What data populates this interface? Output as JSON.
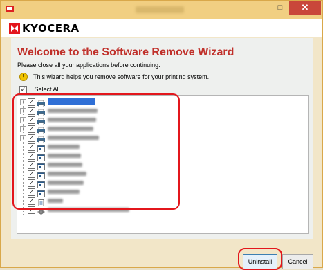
{
  "window": {
    "brand": "KYOCERA",
    "controls": {
      "minimize": "–",
      "maximize": "□",
      "close": "✕"
    }
  },
  "wizard": {
    "heading": "Welcome to the Software Remove Wizard",
    "subheading": "Please close all your applications before continuing.",
    "info": "This wizard helps you remove software for your printing system.",
    "select_all_label": "Select All",
    "select_all_checked": "✓"
  },
  "tree": {
    "rows": [
      {
        "expander": "+",
        "checked": "✓",
        "icon": "printer-icon",
        "selected": true
      },
      {
        "expander": "+",
        "checked": "✓",
        "icon": "printer-icon",
        "selected": false
      },
      {
        "expander": "+",
        "checked": "✓",
        "icon": "printer-icon",
        "selected": false
      },
      {
        "expander": "+",
        "checked": "✓",
        "icon": "printer-icon",
        "selected": false
      },
      {
        "expander": "+",
        "checked": "✓",
        "icon": "printer-icon",
        "selected": false
      },
      {
        "expander": "",
        "checked": "✓",
        "icon": "application-icon",
        "selected": false
      },
      {
        "expander": "",
        "checked": "✓",
        "icon": "application-icon",
        "selected": false
      },
      {
        "expander": "",
        "checked": "✓",
        "icon": "application-icon",
        "selected": false
      },
      {
        "expander": "",
        "checked": "✓",
        "icon": "application-icon",
        "selected": false
      },
      {
        "expander": "",
        "checked": "✓",
        "icon": "application-icon",
        "selected": false
      },
      {
        "expander": "",
        "checked": "✓",
        "icon": "application-icon",
        "selected": false
      },
      {
        "expander": "",
        "checked": "✓",
        "icon": "document-icon",
        "selected": false
      },
      {
        "expander": "",
        "checked": "✓",
        "icon": "gear-icon",
        "selected": false
      }
    ]
  },
  "buttons": {
    "uninstall": "Uninstall",
    "cancel": "Cancel"
  },
  "colors": {
    "heading": "#c0302a",
    "highlight_ring": "#e3161c",
    "selection": "#2f6fd6",
    "titlebar": "#f1cf82"
  }
}
